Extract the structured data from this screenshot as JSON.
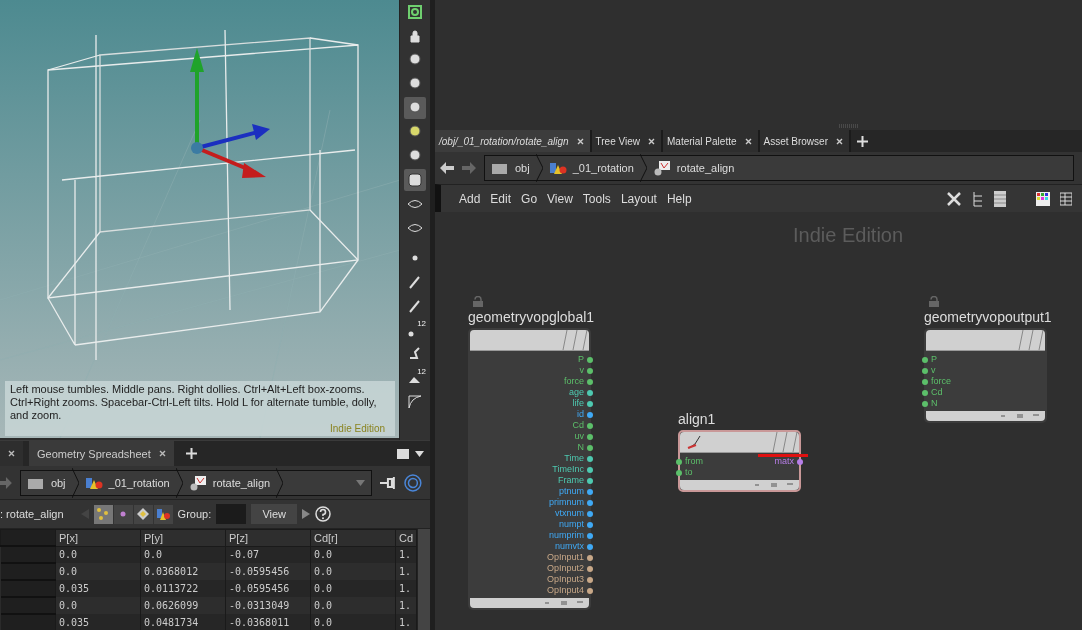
{
  "viewport": {
    "hint": "Left mouse tumbles. Middle pans. Right dollies. Ctrl+Alt+Left box-zooms. Ctrl+Right zooms. Spacebar-Ctrl-Left tilts. Hold L for alternate tumble, dolly, and zoom.",
    "watermark": "Indie Edition"
  },
  "viewport_toolbar": {
    "badges": [
      "12",
      "12"
    ]
  },
  "spreadsheet": {
    "tabs": [
      {
        "selected": false
      },
      {
        "label": "Geometry Spreadsheet",
        "selected": true
      }
    ],
    "path": [
      "obj",
      "_01_rotation",
      "rotate_align"
    ],
    "node_label": ": rotate_align",
    "group_label": "Group:",
    "view_button": "View",
    "columns": [
      "P[x]",
      "P[y]",
      "P[z]",
      "Cd[r]",
      "Cd"
    ],
    "rows": [
      [
        "0.0",
        "0.0",
        "-0.07",
        "0.0",
        "1."
      ],
      [
        "0.0",
        "0.0368012",
        "-0.0595456",
        "0.0",
        "1."
      ],
      [
        "0.035",
        "0.0113722",
        "-0.0595456",
        "0.0",
        "1."
      ],
      [
        "0.0",
        "0.0626099",
        "-0.0313049",
        "0.0",
        "1."
      ],
      [
        "0.035",
        "0.0481734",
        "-0.0368011",
        "0.0",
        "1."
      ]
    ]
  },
  "network": {
    "tabs": [
      {
        "label": "/obj/_01_rotation/rotate_align",
        "selected": true
      },
      {
        "label": "Tree View",
        "selected": false
      },
      {
        "label": "Material Palette",
        "selected": false
      },
      {
        "label": "Asset Browser",
        "selected": false
      }
    ],
    "path": [
      "obj",
      "_01_rotation",
      "rotate_align"
    ],
    "menu": [
      "Add",
      "Edit",
      "Go",
      "View",
      "Tools",
      "Layout",
      "Help"
    ],
    "watermark": "Indie Edition",
    "nodes": [
      {
        "name": "geometryvopglobal1",
        "locked": true,
        "selected": false,
        "outputs": [
          {
            "name": "P",
            "color": "#5cbf6a"
          },
          {
            "name": "v",
            "color": "#5cbf6a"
          },
          {
            "name": "force",
            "color": "#5cbf6a"
          },
          {
            "name": "age",
            "color": "#4ec9b0"
          },
          {
            "name": "life",
            "color": "#4ec9b0"
          },
          {
            "name": "id",
            "color": "#3fa9f5"
          },
          {
            "name": "Cd",
            "color": "#5cbf6a"
          },
          {
            "name": "uv",
            "color": "#5cbf6a"
          },
          {
            "name": "N",
            "color": "#5cbf6a"
          },
          {
            "name": "Time",
            "color": "#4ec9b0"
          },
          {
            "name": "TimeInc",
            "color": "#4ec9b0"
          },
          {
            "name": "Frame",
            "color": "#4ec9b0"
          },
          {
            "name": "ptnum",
            "color": "#3fa9f5"
          },
          {
            "name": "primnum",
            "color": "#3fa9f5"
          },
          {
            "name": "vtxnum",
            "color": "#3fa9f5"
          },
          {
            "name": "numpt",
            "color": "#3fa9f5"
          },
          {
            "name": "numprim",
            "color": "#3fa9f5"
          },
          {
            "name": "numvtx",
            "color": "#3fa9f5"
          },
          {
            "name": "OpInput1",
            "color": "#c8a888"
          },
          {
            "name": "OpInput2",
            "color": "#c8a888"
          },
          {
            "name": "OpInput3",
            "color": "#c8a888"
          },
          {
            "name": "OpInput4",
            "color": "#c8a888"
          }
        ]
      },
      {
        "name": "align1",
        "locked": false,
        "selected": true,
        "inputs": [
          {
            "name": "from",
            "color": "#5cbf6a"
          },
          {
            "name": "to",
            "color": "#5cbf6a"
          }
        ],
        "outputs": [
          {
            "name": "matx",
            "color": "#b77ee8"
          }
        ]
      },
      {
        "name": "geometryvopoutput1",
        "locked": true,
        "selected": false,
        "inputs": [
          {
            "name": "P",
            "color": "#5cbf6a"
          },
          {
            "name": "v",
            "color": "#5cbf6a"
          },
          {
            "name": "force",
            "color": "#5cbf6a"
          },
          {
            "name": "Cd",
            "color": "#5cbf6a"
          },
          {
            "name": "N",
            "color": "#5cbf6a"
          }
        ]
      }
    ]
  }
}
